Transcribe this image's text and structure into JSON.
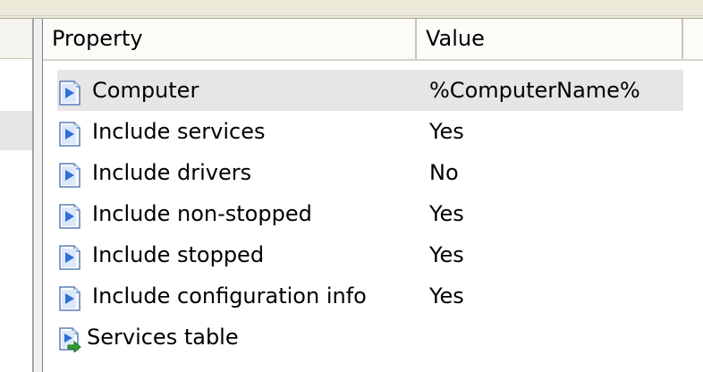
{
  "columns": {
    "property": "Property",
    "value": "Value"
  },
  "rows": [
    {
      "name": "Computer",
      "value": "%ComputerName%",
      "icon": "property-page-icon",
      "selected": true
    },
    {
      "name": "Include services",
      "value": "Yes",
      "icon": "property-page-icon"
    },
    {
      "name": "Include drivers",
      "value": "No",
      "icon": "property-page-icon"
    },
    {
      "name": "Include non-stopped",
      "value": "Yes",
      "icon": "property-page-icon"
    },
    {
      "name": "Include stopped",
      "value": "Yes",
      "icon": "property-page-icon"
    },
    {
      "name": "Include configuration info",
      "value": "Yes",
      "icon": "property-page-icon"
    },
    {
      "name": "Services table",
      "value": "",
      "icon": "table-output-icon"
    }
  ],
  "colors": {
    "selection": "#e6e6e6",
    "icon_blue": "#2f6fd6",
    "icon_green": "#2fa02f"
  }
}
